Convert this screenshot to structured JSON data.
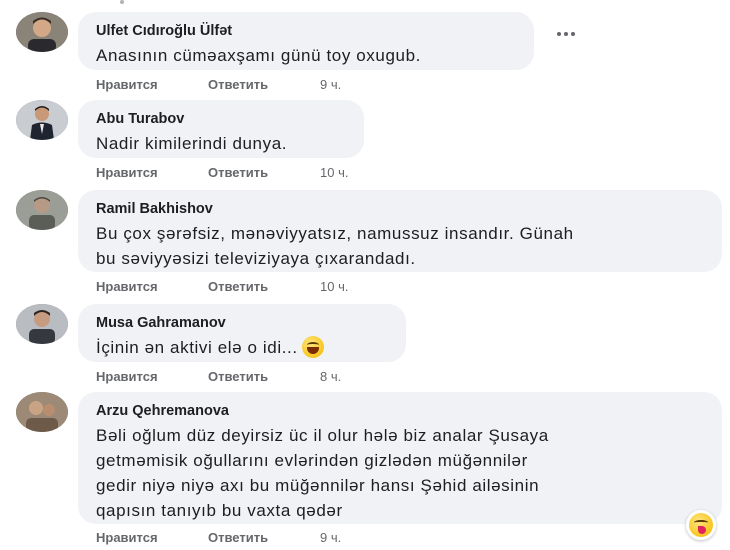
{
  "comments": [
    {
      "author": "Ulfet Cıdıroğlu Ülfət",
      "text": "Anasının cüməaxşamı günü toy oxugub.",
      "like": "Нравится",
      "reply": "Ответить",
      "time": "9 ч."
    },
    {
      "author": "Abu Turabov",
      "text": "Nadir kimilerindi dunya.",
      "like": "Нравится",
      "reply": "Ответить",
      "time": "10 ч."
    },
    {
      "author": "Ramil Bakhishov",
      "text_lines": [
        "Bu çox şərəfsiz, mənəviyyatsız, namussuz insandır. Günah",
        "bu səviyyəsizi televiziyaya çıxarandadı."
      ],
      "like": "Нравится",
      "reply": "Ответить",
      "time": "10 ч."
    },
    {
      "author": "Musa Gahramanov",
      "text": "İçinin ən aktivi elə o idi...",
      "emoji": "grinning-face",
      "like": "Нравится",
      "reply": "Ответить",
      "time": "8 ч."
    },
    {
      "author": "Arzu Qehremanova",
      "text_lines": [
        "Bəli oğlum düz deyirsiz üc il olur hələ biz analar Şusaya",
        "getməmisik oğullarını evlərindən gizlədən müğənnilər",
        "gedir niyə niyə axı bu müğənnilər hansı Şəhid ailəsinin",
        "qapısın tanıyıb bu vaxta qədər"
      ],
      "reaction": "tongue-wink-emoji",
      "like": "Нравится",
      "reply": "Ответить",
      "time": "9 ч."
    }
  ],
  "icons": {
    "more": "more-dots-icon"
  },
  "colors": {
    "bubble": "#f0f2f5",
    "meta": "#65676b",
    "text": "#1c1e21"
  }
}
